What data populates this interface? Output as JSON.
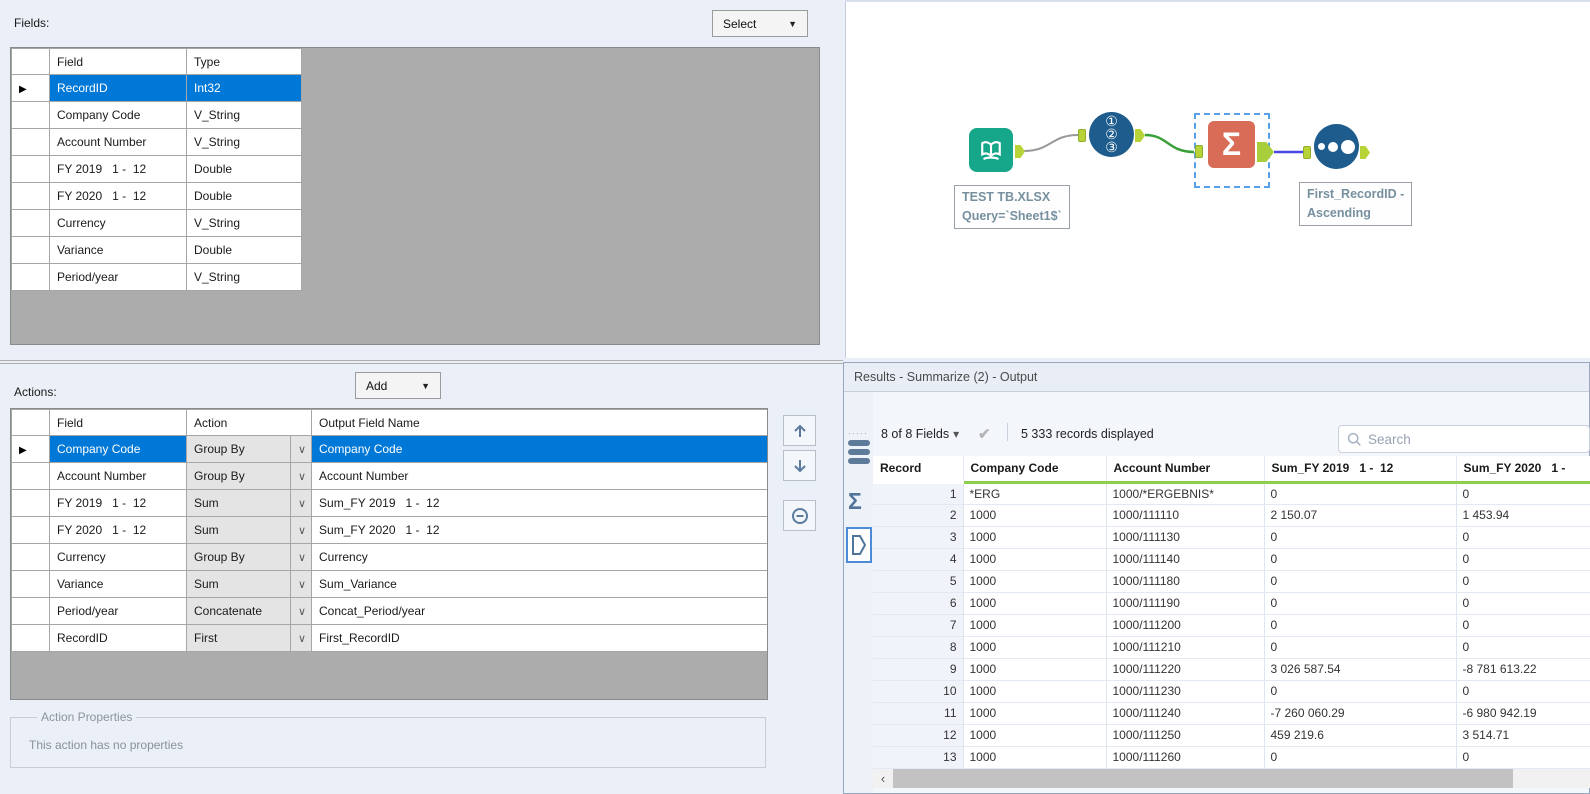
{
  "left_panel": {
    "fields_label": "Fields:",
    "select_button_label": "Select",
    "fields_table": {
      "headers": [
        "Field",
        "Type"
      ],
      "rows": [
        {
          "field": "RecordID",
          "type": "Int32",
          "selected": true
        },
        {
          "field": "Company Code",
          "type": "V_String"
        },
        {
          "field": "Account Number",
          "type": "V_String"
        },
        {
          "field": "FY 2019   1 -  12",
          "type": "Double"
        },
        {
          "field": "FY 2020   1 -  12",
          "type": "Double"
        },
        {
          "field": "Currency",
          "type": "V_String"
        },
        {
          "field": "Variance",
          "type": "Double"
        },
        {
          "field": "Period/year",
          "type": "V_String"
        }
      ]
    },
    "actions_label": "Actions:",
    "add_button_label": "Add",
    "actions_table": {
      "headers": [
        "Field",
        "Action",
        "Output Field Name"
      ],
      "rows": [
        {
          "field": "Company Code",
          "action": "Group By",
          "output": "Company Code",
          "selected": true
        },
        {
          "field": "Account Number",
          "action": "Group By",
          "output": "Account Number"
        },
        {
          "field": "FY 2019   1 -  12",
          "action": "Sum",
          "output": "Sum_FY 2019   1 -  12"
        },
        {
          "field": "FY 2020   1 -  12",
          "action": "Sum",
          "output": "Sum_FY 2020   1 -  12"
        },
        {
          "field": "Currency",
          "action": "Group By",
          "output": "Currency"
        },
        {
          "field": "Variance",
          "action": "Sum",
          "output": "Sum_Variance"
        },
        {
          "field": "Period/year",
          "action": "Concatenate",
          "output": "Concat_Period/year"
        },
        {
          "field": "RecordID",
          "action": "First",
          "output": "First_RecordID"
        }
      ]
    },
    "action_properties": {
      "legend": "Action Properties",
      "message": "This action has no properties"
    }
  },
  "canvas": {
    "input_annotation": {
      "line1": "TEST TB.XLSX",
      "line2": "Query=`Sheet1$`"
    },
    "sort_annotation": {
      "line1": "First_RecordID -",
      "line2": "Ascending"
    }
  },
  "results": {
    "title": "Results - Summarize (2) - Output",
    "fields_summary": "8 of 8 Fields",
    "records_text": "5 333 records displayed",
    "search_placeholder": "Search",
    "grid": {
      "columns": [
        "Record",
        "Company Code",
        "Account Number",
        "Sum_FY 2019   1 -  12",
        "Sum_FY 2020   1 -"
      ],
      "rows": [
        [
          "1",
          "*ERG",
          "1000/*ERGEBNIS*",
          "0",
          "0"
        ],
        [
          "2",
          "1000",
          "1000/111110",
          "2 150.07",
          "1 453.94"
        ],
        [
          "3",
          "1000",
          "1000/111130",
          "0",
          "0"
        ],
        [
          "4",
          "1000",
          "1000/111140",
          "0",
          "0"
        ],
        [
          "5",
          "1000",
          "1000/111180",
          "0",
          "0"
        ],
        [
          "6",
          "1000",
          "1000/111190",
          "0",
          "0"
        ],
        [
          "7",
          "1000",
          "1000/111200",
          "0",
          "0"
        ],
        [
          "8",
          "1000",
          "1000/111210",
          "0",
          "0"
        ],
        [
          "9",
          "1000",
          "1000/111220",
          "3 026 587.54",
          "-8 781 613.22"
        ],
        [
          "10",
          "1000",
          "1000/111230",
          "0",
          "0"
        ],
        [
          "11",
          "1000",
          "1000/111240",
          "-7 260 060.29",
          "-6 980 942.19"
        ],
        [
          "12",
          "1000",
          "1000/111250",
          "459 219.6",
          "3 514.71"
        ],
        [
          "13",
          "1000",
          "1000/111260",
          "0",
          "0"
        ]
      ]
    }
  },
  "colors": {
    "selection_blue": "#0078D7",
    "anchor_green": "#B6D437",
    "summarize_salmon": "#D96C57",
    "tool_blue": "#1D5C8C",
    "input_teal": "#16A689",
    "header_underline_green": "#8CCF4D",
    "wire_green": "#3AA03A",
    "wire_blue": "#4848E8",
    "wire_gray": "#9A9A9A"
  }
}
